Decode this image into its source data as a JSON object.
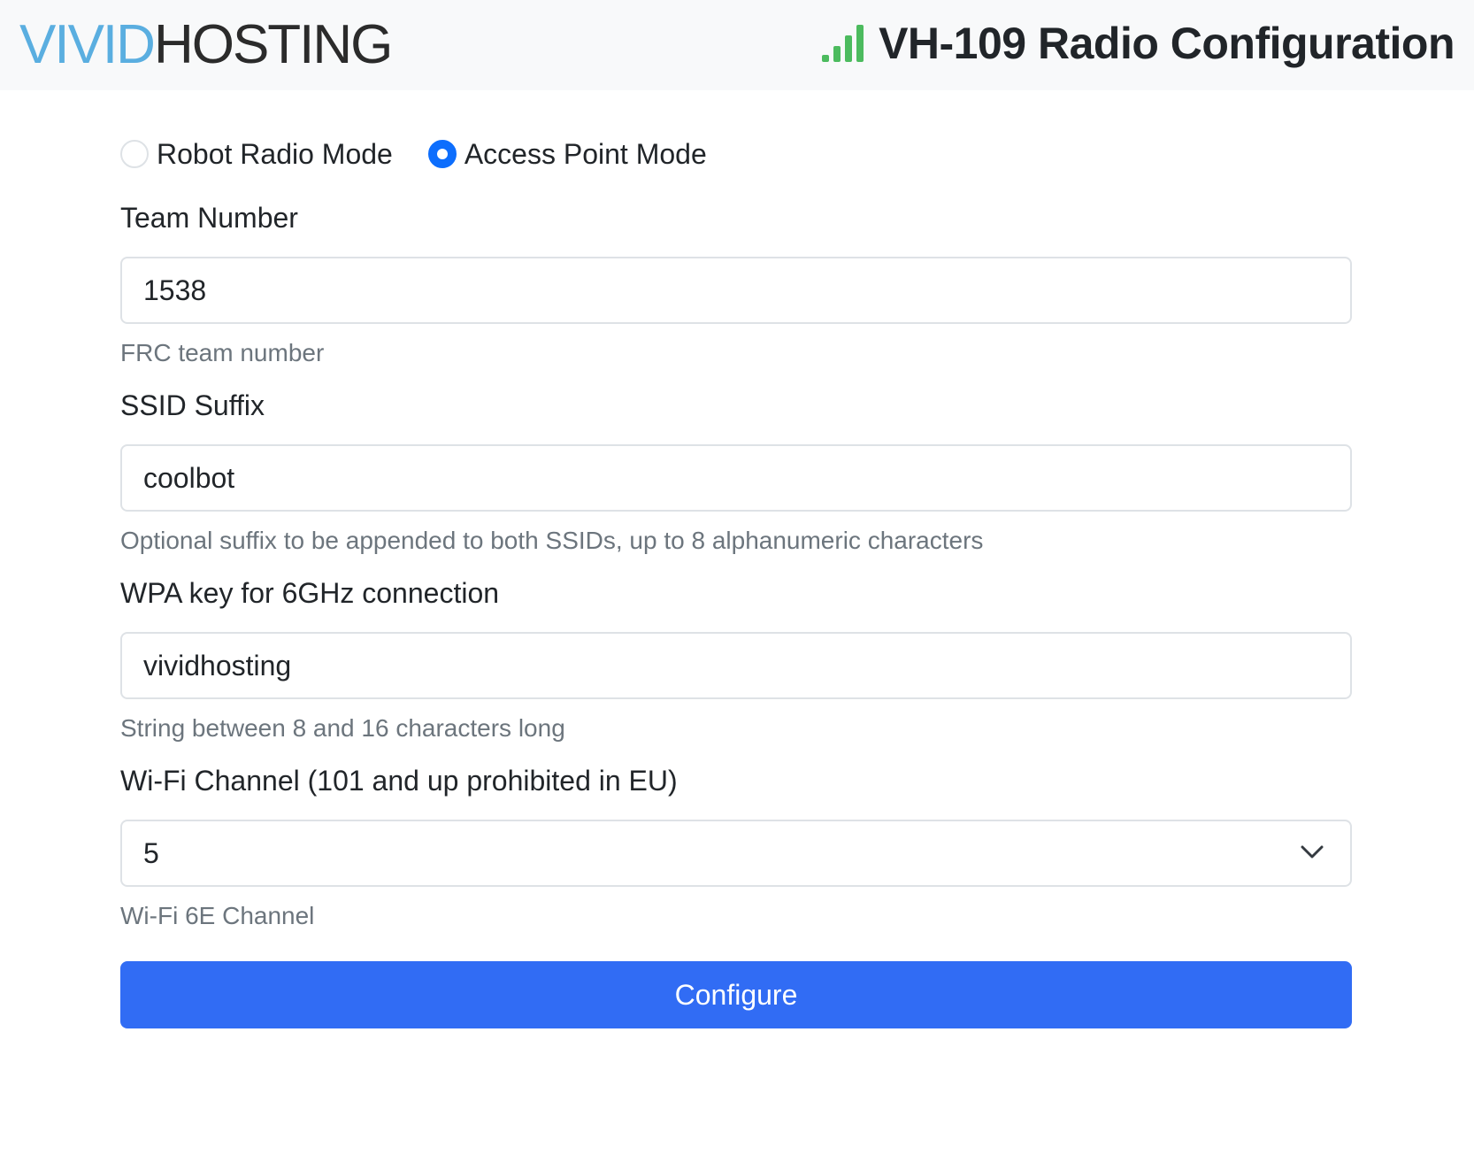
{
  "header": {
    "logo_vivid": "VIVID",
    "logo_hosting": "HOSTING",
    "title": "VH-109 Radio Configuration",
    "signal_icon": "signal-bars-icon",
    "signal_color": "#4cbb5e"
  },
  "mode": {
    "options": [
      {
        "label": "Robot Radio Mode",
        "checked": false
      },
      {
        "label": "Access Point Mode",
        "checked": true
      }
    ]
  },
  "fields": {
    "team_number": {
      "label": "Team Number",
      "value": "1538",
      "help": "FRC team number"
    },
    "ssid_suffix": {
      "label": "SSID Suffix",
      "value": "coolbot",
      "help": "Optional suffix to be appended to both SSIDs, up to 8 alphanumeric characters"
    },
    "wpa_key": {
      "label": "WPA key for 6GHz connection",
      "value": "vividhosting",
      "help": "String between 8 and 16 characters long"
    },
    "channel": {
      "label": "Wi-Fi Channel (101 and up prohibited in EU)",
      "value": "5",
      "help": "Wi-Fi 6E Channel",
      "icon": "chevron-down-icon"
    }
  },
  "actions": {
    "configure_label": "Configure",
    "accent_color": "#316cf4"
  }
}
